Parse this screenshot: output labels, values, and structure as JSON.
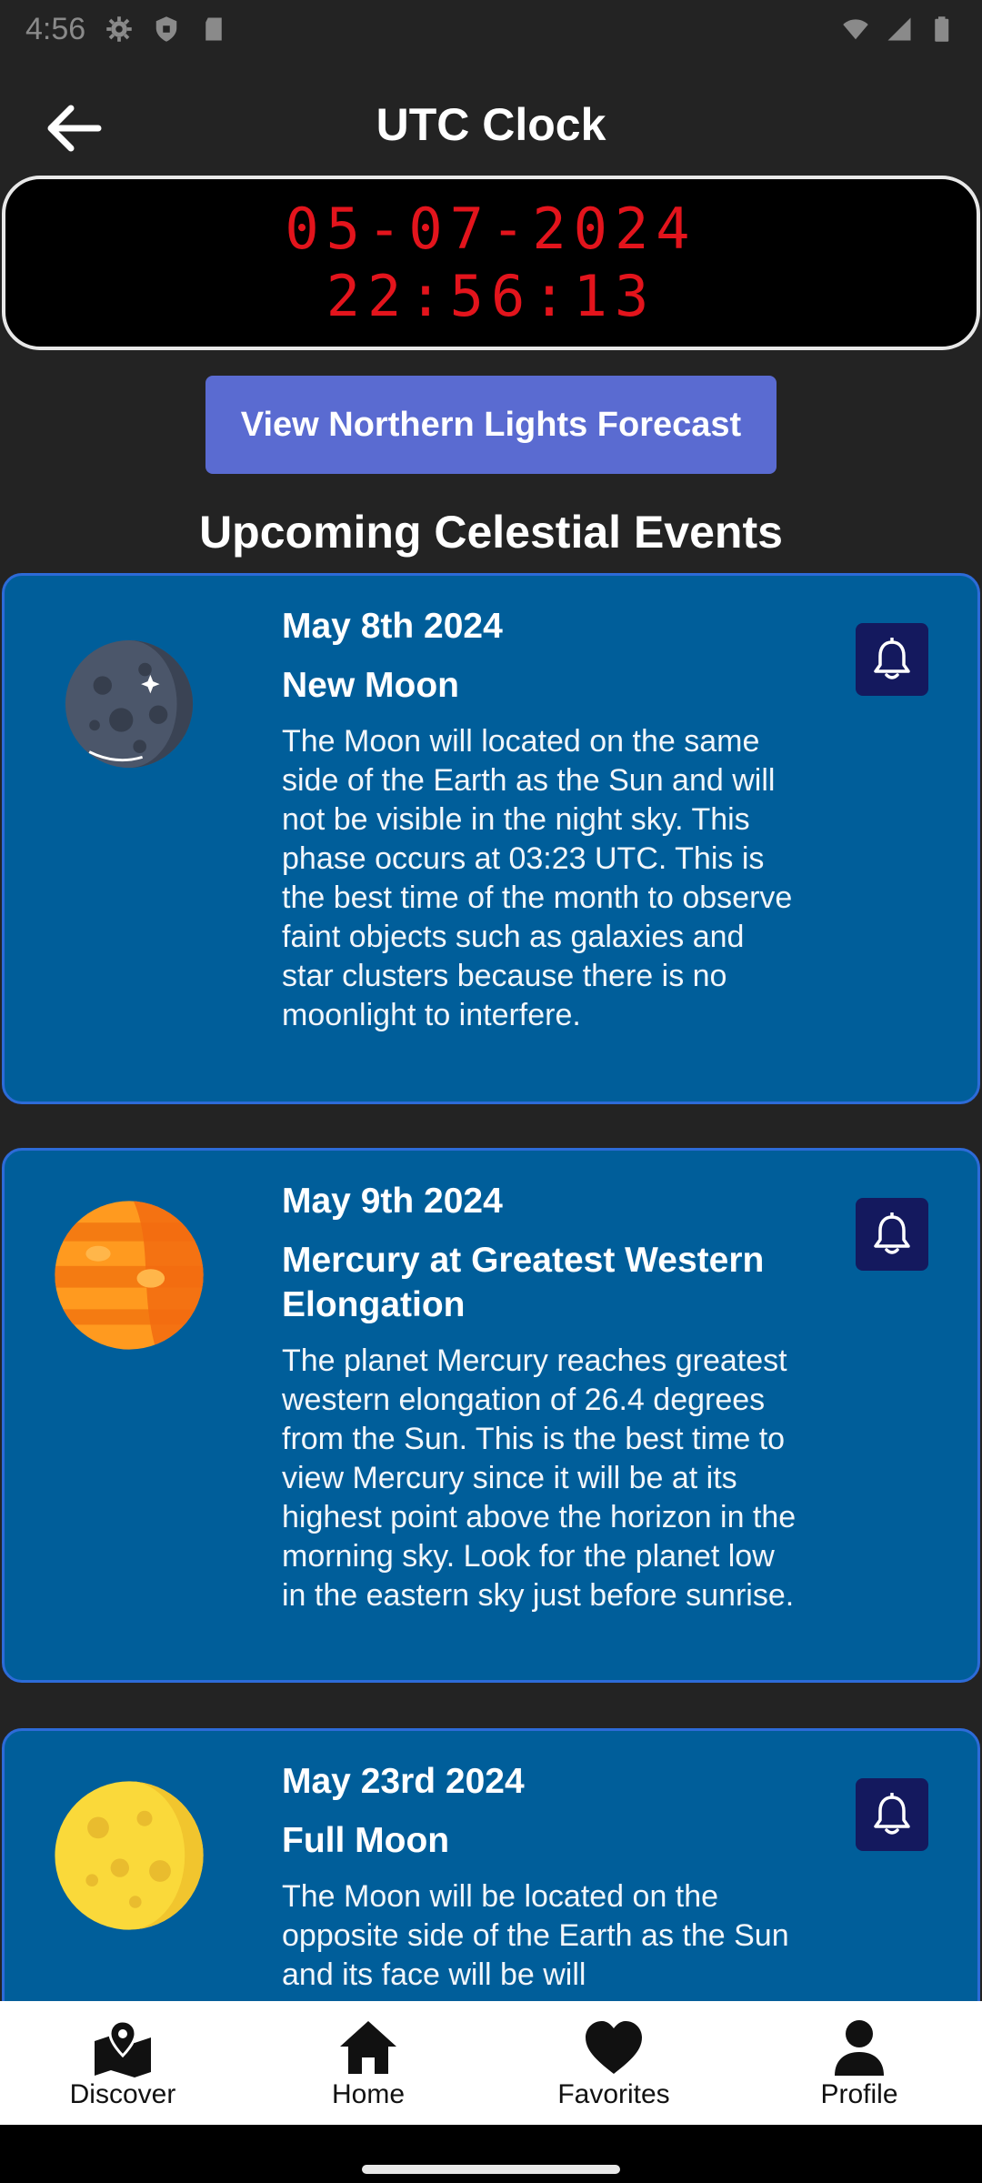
{
  "status_bar": {
    "time": "4:56"
  },
  "header": {
    "title": "UTC Clock"
  },
  "clock": {
    "date": "05-07-2024",
    "time": "22:56:13"
  },
  "aurora_button": {
    "label": "View Northern Lights Forecast"
  },
  "events_section": {
    "title": "Upcoming Celestial Events"
  },
  "events": [
    {
      "date": "May 8th 2024",
      "title": "New Moon",
      "description": "The Moon will located on the same side of the Earth as the Sun and will not be visible in the night sky. This phase occurs at 03:23 UTC. This is the best time of the month to observe faint objects such as galaxies and star clusters because there is no moonlight to interfere.",
      "icon": "new-moon-icon"
    },
    {
      "date": "May 9th 2024",
      "title": "Mercury at Greatest Western Elongation",
      "description": "The planet Mercury reaches greatest western elongation of 26.4 degrees from the Sun. This is the best time to view Mercury since it will be at its highest point above the horizon in the morning sky. Look for the planet low in the eastern sky just before sunrise.",
      "icon": "mercury-planet-icon"
    },
    {
      "date": "May 23rd 2024",
      "title": "Full Moon",
      "description": "The Moon will be located on the opposite side of the Earth as the Sun and its face will be will",
      "icon": "full-moon-icon"
    }
  ],
  "bottom_nav": {
    "items": [
      {
        "label": "Discover",
        "icon": "map-pin-icon"
      },
      {
        "label": "Home",
        "icon": "home-icon"
      },
      {
        "label": "Favorites",
        "icon": "heart-icon"
      },
      {
        "label": "Profile",
        "icon": "person-icon"
      }
    ]
  },
  "colors": {
    "background": "#232323",
    "card": "#005e9a",
    "card_border": "#2d6bd8",
    "bell_button": "#14195e",
    "aurora_button": "#5a6bd1",
    "clock_digits": "#e3141c"
  }
}
